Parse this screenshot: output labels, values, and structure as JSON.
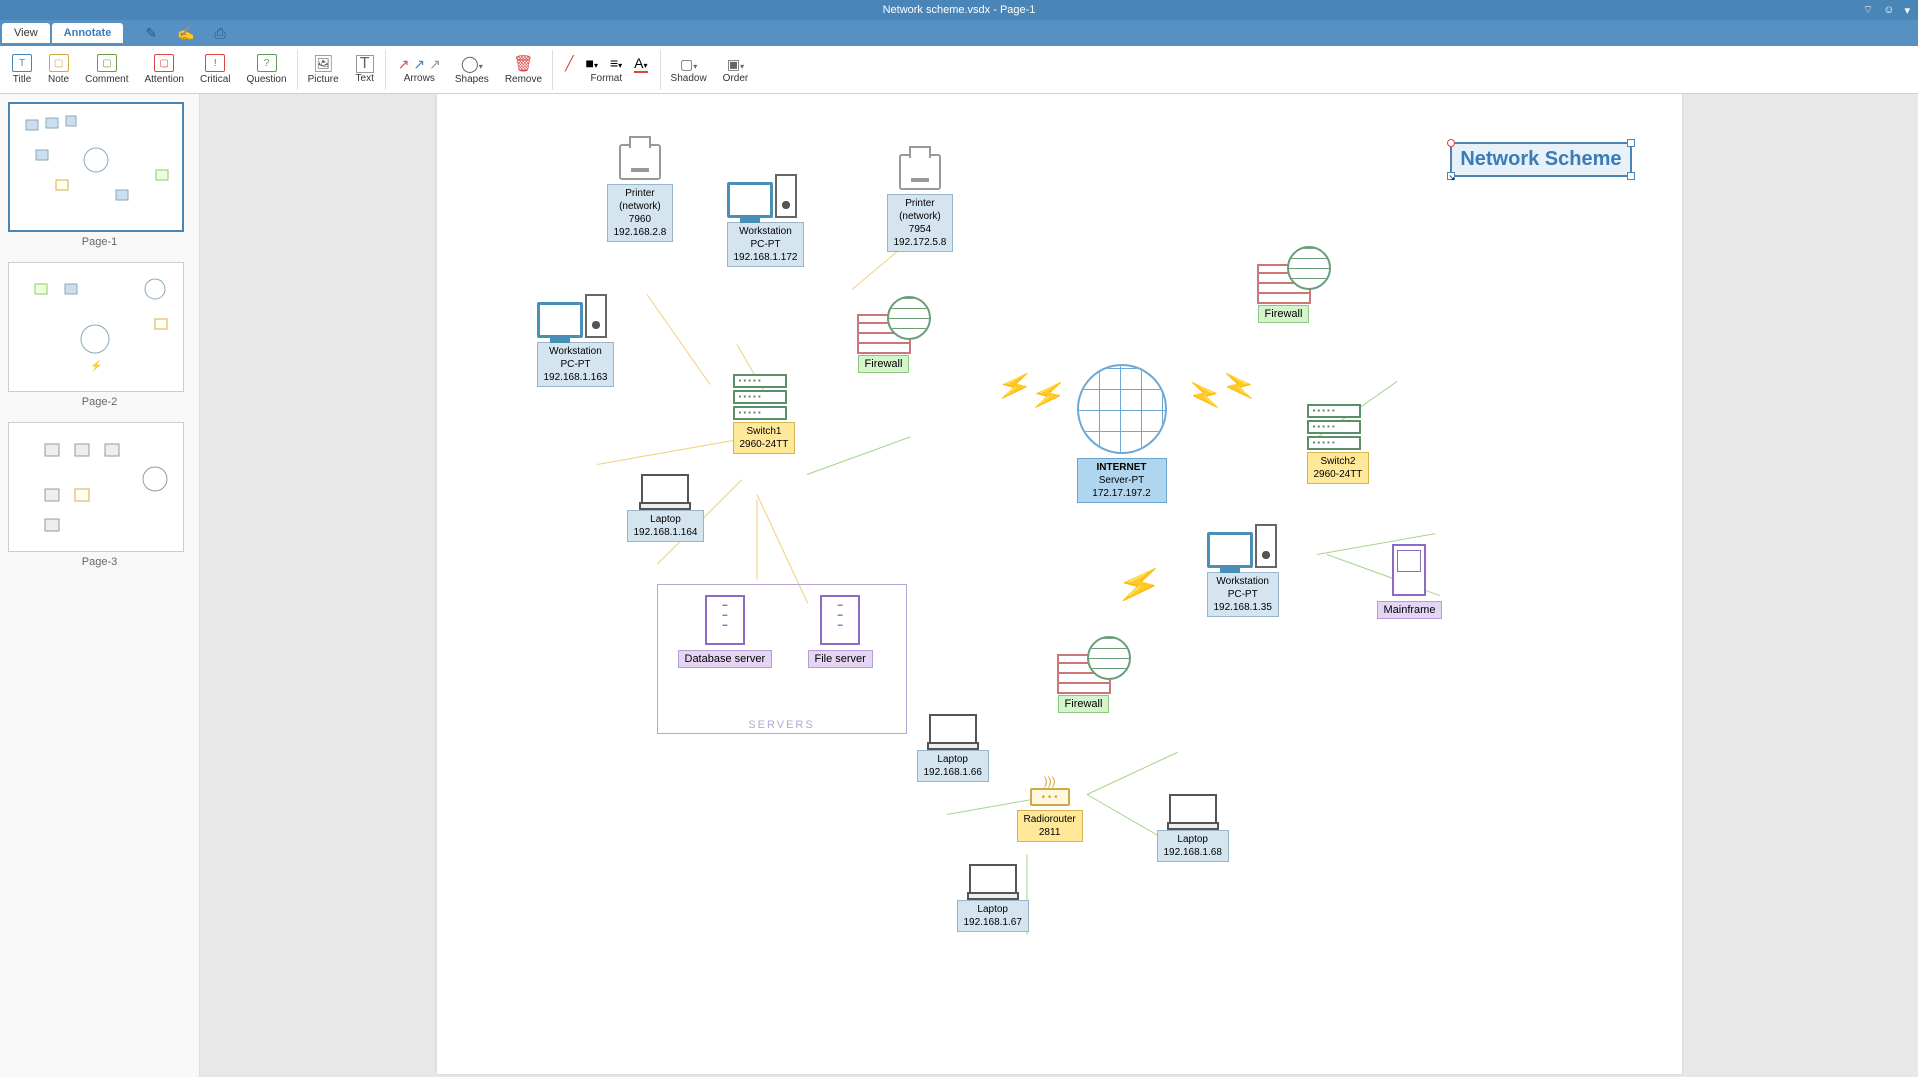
{
  "window": {
    "title": "Network scheme.vsdx - Page-1"
  },
  "tabs": {
    "view": "View",
    "annotate": "Annotate"
  },
  "ribbon": {
    "title": "Title",
    "note": "Note",
    "comment": "Comment",
    "attention": "Attention",
    "critical": "Critical",
    "question": "Question",
    "picture": "Picture",
    "text": "Text",
    "arrows": "Arrows",
    "shapes": "Shapes",
    "remove": "Remove",
    "format": "Format",
    "shadow": "Shadow",
    "order": "Order"
  },
  "thumbs": {
    "p1": "Page-1",
    "p2": "Page-2",
    "p3": "Page-3"
  },
  "canvas": {
    "title": "Network Scheme",
    "printer1": {
      "name": "Printer",
      "sub": "(network)",
      "id": "7960",
      "ip": "192.168.2.8"
    },
    "printer2": {
      "name": "Printer",
      "sub": "(network)",
      "id": "7954",
      "ip": "192.172.5.8"
    },
    "ws1": {
      "name": "Workstation",
      "model": "PC-PT",
      "ip": "192.168.1.172"
    },
    "ws2": {
      "name": "Workstation",
      "model": "PC-PT",
      "ip": "192.168.1.163"
    },
    "ws3": {
      "name": "Workstation",
      "model": "PC-PT",
      "ip": "192.168.1.35"
    },
    "switch1": {
      "name": "Switch1",
      "model": "2960-24TT"
    },
    "switch2": {
      "name": "Switch2",
      "model": "2960-24TT"
    },
    "laptop1": {
      "name": "Laptop",
      "ip": "192.168.1.164"
    },
    "laptop2": {
      "name": "Laptop",
      "ip": "192.168.1.66"
    },
    "laptop3": {
      "name": "Laptop",
      "ip": "192.168.1.67"
    },
    "laptop4": {
      "name": "Laptop",
      "ip": "192.168.1.68"
    },
    "firewall1": "Firewall",
    "firewall2": "Firewall",
    "firewall3": "Firewall",
    "internet": {
      "name": "INTERNET",
      "model": "Server-PT",
      "ip": "172.17.197.2"
    },
    "dbserver": "Database server",
    "fileserver": "File server",
    "serversLabel": "SERVERS",
    "mainframe": "Mainframe",
    "radiorouter": {
      "name": "Radiorouter",
      "model": "2811"
    }
  }
}
